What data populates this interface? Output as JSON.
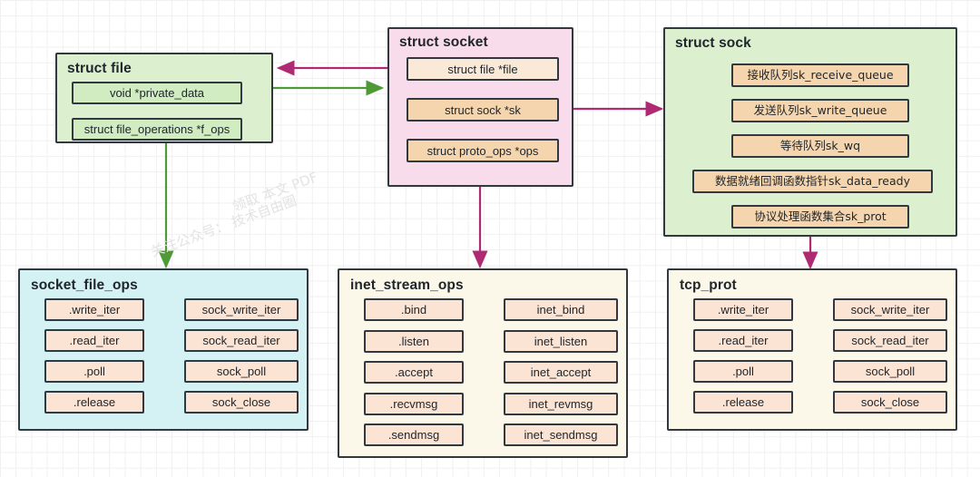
{
  "colors": {
    "green_group": "#dcf0d0",
    "pink_group": "#f9dcec",
    "cyan_group": "#d4f2f4",
    "cream_group": "#fbf8e9",
    "peach_field": "#f5d5ae",
    "light_peach_field": "#fbe9d8",
    "green_field": "#d0ecc0",
    "border": "#32383f",
    "green_arrow": "#4f9a36",
    "magenta_arrow": "#b02a73",
    "black_arrow": "#1f1f1f"
  },
  "struct_file": {
    "title": "struct file",
    "fields": [
      {
        "label": "void *private_data"
      },
      {
        "label": "struct file_operations *f_ops"
      }
    ]
  },
  "struct_socket": {
    "title": "struct socket",
    "fields": [
      {
        "label": "struct file *file"
      },
      {
        "label": "struct sock *sk"
      },
      {
        "label": "struct proto_ops *ops"
      }
    ]
  },
  "struct_sock": {
    "title": "struct sock",
    "fields": [
      {
        "label": "接收队列sk_receive_queue"
      },
      {
        "label": "发送队列sk_write_queue"
      },
      {
        "label": "等待队列sk_wq"
      },
      {
        "label": "数据就绪回调函数指针sk_data_ready"
      },
      {
        "label": "协议处理函数集合sk_prot"
      }
    ]
  },
  "socket_file_ops": {
    "title": "socket_file_ops",
    "rows": [
      {
        "op": ".write_iter",
        "impl": "sock_write_iter"
      },
      {
        "op": ".read_iter",
        "impl": "sock_read_iter"
      },
      {
        "op": ".poll",
        "impl": "sock_poll"
      },
      {
        "op": ".release",
        "impl": "sock_close"
      }
    ]
  },
  "inet_stream_ops": {
    "title": "inet_stream_ops",
    "rows": [
      {
        "op": ".bind",
        "impl": "inet_bind"
      },
      {
        "op": ".listen",
        "impl": "inet_listen"
      },
      {
        "op": ".accept",
        "impl": "inet_accept"
      },
      {
        "op": ".recvmsg",
        "impl": "inet_revmsg"
      },
      {
        "op": ".sendmsg",
        "impl": "inet_sendmsg"
      }
    ]
  },
  "tcp_prot": {
    "title": "tcp_prot",
    "rows": [
      {
        "op": ".write_iter",
        "impl": "sock_write_iter"
      },
      {
        "op": ".read_iter",
        "impl": "sock_read_iter"
      },
      {
        "op": ".poll",
        "impl": "sock_poll"
      },
      {
        "op": ".release",
        "impl": "sock_close"
      }
    ]
  },
  "watermark": {
    "line1": "领取 本文 PDF",
    "line2": "关注公众号： 技术自由圈"
  }
}
